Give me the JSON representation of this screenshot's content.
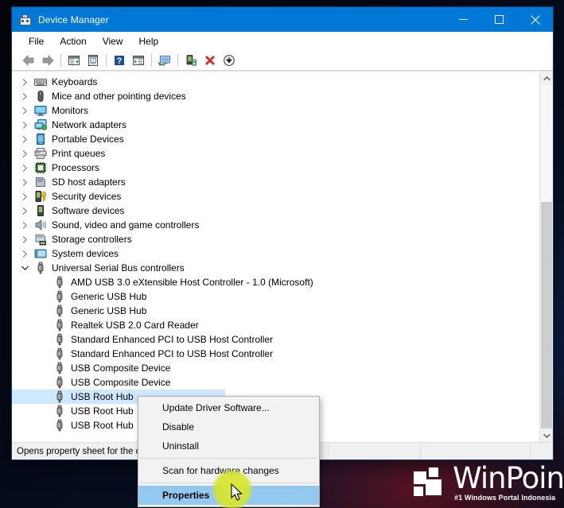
{
  "window": {
    "title": "Device Manager",
    "icon": "device-manager-icon",
    "controls": [
      {
        "name": "minimize-button",
        "glyph": "minimize"
      },
      {
        "name": "maximize-button",
        "glyph": "maximize"
      },
      {
        "name": "close-button",
        "glyph": "close"
      }
    ]
  },
  "menubar": {
    "items": [
      {
        "label": "File",
        "name": "menu-file"
      },
      {
        "label": "Action",
        "name": "menu-action"
      },
      {
        "label": "View",
        "name": "menu-view"
      },
      {
        "label": "Help",
        "name": "menu-help"
      }
    ]
  },
  "toolbar": {
    "buttons": [
      {
        "name": "back-button",
        "icon": "back-arrow-icon"
      },
      {
        "name": "forward-button",
        "icon": "forward-arrow-icon"
      },
      {
        "name": "show-hide-console-tree-button",
        "icon": "console-tree-icon"
      },
      {
        "name": "properties-button",
        "icon": "properties-icon"
      },
      {
        "name": "help-button",
        "icon": "help-question-icon"
      },
      {
        "name": "show-hide-action-pane-button",
        "icon": "action-pane-icon"
      },
      {
        "name": "scan-for-hardware-changes-button",
        "icon": "monitor-scan-icon"
      },
      {
        "name": "update-driver-button",
        "icon": "update-driver-icon"
      },
      {
        "name": "uninstall-device-button",
        "icon": "red-x-icon"
      },
      {
        "name": "disable-device-button",
        "icon": "down-arrow-circle-icon"
      }
    ]
  },
  "tree": {
    "items": [
      {
        "label": "Keyboards",
        "icon": "keyboard-icon",
        "depth": 1,
        "expander": "collapsed",
        "selected": false
      },
      {
        "label": "Mice and other pointing devices",
        "icon": "mouse-icon",
        "depth": 1,
        "expander": "collapsed",
        "selected": false
      },
      {
        "label": "Monitors",
        "icon": "monitor-icon",
        "depth": 1,
        "expander": "collapsed",
        "selected": false
      },
      {
        "label": "Network adapters",
        "icon": "network-adapter-icon",
        "depth": 1,
        "expander": "collapsed",
        "selected": false
      },
      {
        "label": "Portable Devices",
        "icon": "portable-device-icon",
        "depth": 1,
        "expander": "collapsed",
        "selected": false
      },
      {
        "label": "Print queues",
        "icon": "printer-icon",
        "depth": 1,
        "expander": "collapsed",
        "selected": false
      },
      {
        "label": "Processors",
        "icon": "processor-icon",
        "depth": 1,
        "expander": "collapsed",
        "selected": false
      },
      {
        "label": "SD host adapters",
        "icon": "sd-host-adapter-icon",
        "depth": 1,
        "expander": "collapsed",
        "selected": false
      },
      {
        "label": "Security devices",
        "icon": "security-device-icon",
        "depth": 1,
        "expander": "collapsed",
        "selected": false
      },
      {
        "label": "Software devices",
        "icon": "software-device-icon",
        "depth": 1,
        "expander": "collapsed",
        "selected": false
      },
      {
        "label": "Sound, video and game controllers",
        "icon": "speaker-icon",
        "depth": 1,
        "expander": "collapsed",
        "selected": false
      },
      {
        "label": "Storage controllers",
        "icon": "storage-controller-icon",
        "depth": 1,
        "expander": "collapsed",
        "selected": false
      },
      {
        "label": "System devices",
        "icon": "system-device-icon",
        "depth": 1,
        "expander": "collapsed",
        "selected": false
      },
      {
        "label": "Universal Serial Bus controllers",
        "icon": "usb-icon",
        "depth": 1,
        "expander": "expanded",
        "selected": false
      },
      {
        "label": "AMD USB 3.0 eXtensible Host Controller - 1.0 (Microsoft)",
        "icon": "usb-icon",
        "depth": 2,
        "expander": "none",
        "selected": false
      },
      {
        "label": "Generic USB Hub",
        "icon": "usb-icon",
        "depth": 2,
        "expander": "none",
        "selected": false
      },
      {
        "label": "Generic USB Hub",
        "icon": "usb-icon",
        "depth": 2,
        "expander": "none",
        "selected": false
      },
      {
        "label": "Realtek USB 2.0 Card Reader",
        "icon": "usb-icon",
        "depth": 2,
        "expander": "none",
        "selected": false
      },
      {
        "label": "Standard Enhanced PCI to USB Host Controller",
        "icon": "usb-icon",
        "depth": 2,
        "expander": "none",
        "selected": false
      },
      {
        "label": "Standard Enhanced PCI to USB Host Controller",
        "icon": "usb-icon",
        "depth": 2,
        "expander": "none",
        "selected": false
      },
      {
        "label": "USB Composite Device",
        "icon": "usb-icon",
        "depth": 2,
        "expander": "none",
        "selected": false
      },
      {
        "label": "USB Composite Device",
        "icon": "usb-icon",
        "depth": 2,
        "expander": "none",
        "selected": false
      },
      {
        "label": "USB Root Hub",
        "icon": "usb-icon",
        "depth": 2,
        "expander": "none",
        "selected": true
      },
      {
        "label": "USB Root Hub",
        "icon": "usb-icon",
        "depth": 2,
        "expander": "none",
        "selected": false
      },
      {
        "label": "USB Root Hub",
        "icon": "usb-icon",
        "depth": 2,
        "expander": "none",
        "selected": false
      }
    ]
  },
  "context_menu": {
    "items": [
      {
        "label": "Update Driver Software...",
        "name": "ctx-update-driver-software",
        "highlight": false
      },
      {
        "label": "Disable",
        "name": "ctx-disable",
        "highlight": false
      },
      {
        "label": "Uninstall",
        "name": "ctx-uninstall",
        "highlight": false
      },
      {
        "separator": true
      },
      {
        "label": "Scan for hardware changes",
        "name": "ctx-scan-for-hardware-changes",
        "highlight": false
      },
      {
        "separator": true
      },
      {
        "label": "Properties",
        "name": "ctx-properties",
        "highlight": true
      }
    ]
  },
  "statusbar": {
    "text": "Opens property sheet for the c",
    "pane2": "",
    "pane3": "",
    "pane4": ""
  },
  "watermark": {
    "title": "WinPoin",
    "subtitle": "#1 Windows Portal Indonesia"
  },
  "colors": {
    "titlebar": "#0078d7",
    "selection": "#cde8ff",
    "menu_highlight": "#93c9f0",
    "cursor_glow": "#dee828",
    "red_x": "#d32f2f"
  }
}
